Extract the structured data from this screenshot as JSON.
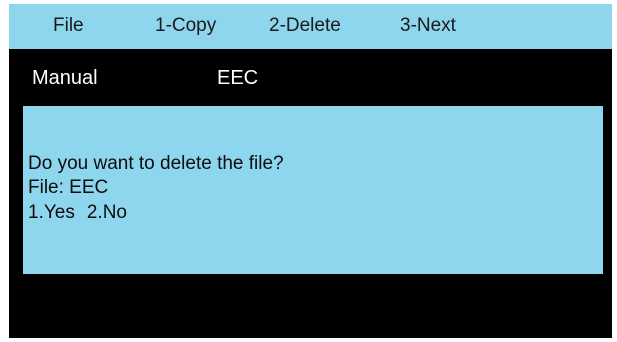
{
  "menu": {
    "file": "File",
    "copy": "1-Copy",
    "delete": "2-Delete",
    "next": "3-Next"
  },
  "status": {
    "mode": "Manual",
    "file_name": "EEC"
  },
  "dialog": {
    "question": "Do you want to delete the file?",
    "file_line": "File: EEC",
    "option_yes": "1.Yes",
    "option_no": "2.No"
  },
  "colors": {
    "panel_blue": "#8dd6ee",
    "screen_black": "#000000"
  }
}
